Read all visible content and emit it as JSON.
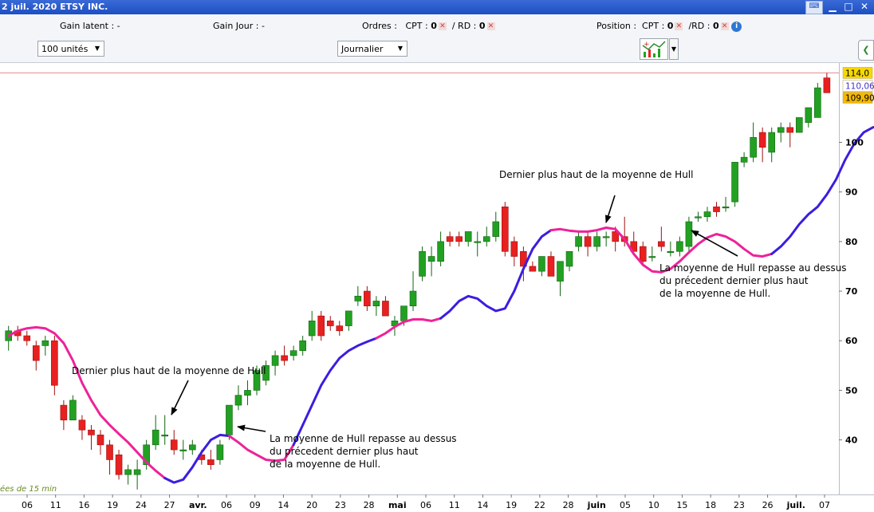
{
  "window": {
    "title": "2 juil. 2020 ETSY INC."
  },
  "infobar": {
    "gain_latent_label": "Gain latent :",
    "gain_latent_value": "-",
    "gain_jour_label": "Gain Jour :",
    "gain_jour_value": "-",
    "ordres_label": "Ordres :",
    "ordres_cpt_label": "CPT :",
    "ordres_cpt_value": "0",
    "ordres_rd_label": "/ RD :",
    "ordres_rd_value": "0",
    "position_label": "Position :",
    "position_cpt_label": "CPT :",
    "position_cpt_value": "0",
    "position_rd_label": "/RD :",
    "position_rd_value": "0"
  },
  "toolbar": {
    "units_value": "100 unités",
    "period_value": "Journalier"
  },
  "footer_note": "ées de 15 min",
  "annotations": [
    "Dernier plus haut de la moyenne de Hull",
    "La moyenne de Hull repasse au dessus\ndu précedent dernier plus haut\nde la moyenne de Hull.",
    "Dernier plus haut de la moyenne de Hull",
    "La moyenne de Hull repasse au dessus\ndu précedent dernier plus haut\nde la moyenne de Hull."
  ],
  "colors": {
    "up": "#22a022",
    "down": "#e82020",
    "hull_rising": "#3a1ee0",
    "hull_falling": "#ee2299",
    "price_line": "#e38a8a"
  },
  "chart_data": {
    "type": "candlestick",
    "ylim": [
      29,
      116
    ],
    "y_ticks": [
      40,
      50,
      60,
      70,
      80,
      90,
      100
    ],
    "x_tick_labels": [
      "06",
      "11",
      "16",
      "19",
      "24",
      "27",
      "avr.",
      "06",
      "09",
      "14",
      "20",
      "23",
      "28",
      "mai",
      "06",
      "11",
      "14",
      "19",
      "22",
      "28",
      "juin",
      "05",
      "10",
      "15",
      "18",
      "23",
      "26",
      "juil.",
      "07"
    ],
    "bold_x_labels": [
      "avr.",
      "mai",
      "juin",
      "juil."
    ],
    "price_tags": [
      {
        "label": "114,0",
        "value": 114.0
      },
      {
        "label": "110,06",
        "value": 110.06
      },
      {
        "label": "109,90",
        "value": 109.9
      }
    ],
    "candles": [
      [
        60,
        63,
        58,
        62
      ],
      [
        62,
        63,
        60,
        61
      ],
      [
        61,
        62,
        59,
        60
      ],
      [
        59,
        60,
        54,
        56
      ],
      [
        59,
        61,
        57,
        60
      ],
      [
        60,
        61,
        49,
        51
      ],
      [
        47,
        48,
        42,
        44
      ],
      [
        44,
        49,
        44,
        48
      ],
      [
        44,
        45,
        40,
        42
      ],
      [
        42,
        43,
        38,
        41
      ],
      [
        41,
        42,
        37,
        39
      ],
      [
        39,
        40,
        33,
        36
      ],
      [
        37,
        38,
        32,
        33
      ],
      [
        33,
        35,
        31,
        34
      ],
      [
        33,
        36,
        30,
        34
      ],
      [
        35,
        40,
        34,
        39
      ],
      [
        39,
        45,
        38,
        42
      ],
      [
        41,
        45,
        39,
        41
      ],
      [
        40,
        42,
        37,
        38
      ],
      [
        38,
        40,
        36,
        38
      ],
      [
        38,
        40,
        37,
        39
      ],
      [
        37,
        38,
        35,
        36
      ],
      [
        36,
        38,
        34,
        35
      ],
      [
        36,
        40,
        35,
        39
      ],
      [
        41,
        47,
        40,
        47
      ],
      [
        47,
        51,
        46,
        49
      ],
      [
        49,
        52,
        47,
        50
      ],
      [
        50,
        55,
        49,
        54
      ],
      [
        52,
        56,
        51,
        55
      ],
      [
        55,
        58,
        53,
        57
      ],
      [
        57,
        59,
        55,
        56
      ],
      [
        57,
        59,
        56,
        58
      ],
      [
        58,
        61,
        57,
        60
      ],
      [
        61,
        66,
        60,
        64
      ],
      [
        65,
        66,
        60,
        61
      ],
      [
        64,
        65,
        62,
        63
      ],
      [
        63,
        64,
        61,
        62
      ],
      [
        63,
        66,
        62,
        66
      ],
      [
        68,
        71,
        67,
        69
      ],
      [
        70,
        71,
        66,
        67
      ],
      [
        67,
        69,
        65,
        68
      ],
      [
        68,
        69,
        65,
        65
      ],
      [
        63,
        65,
        61,
        64
      ],
      [
        64,
        67,
        63,
        67
      ],
      [
        67,
        74,
        66,
        70
      ],
      [
        73,
        79,
        72,
        78
      ],
      [
        76,
        79,
        73,
        77
      ],
      [
        76,
        82,
        75,
        80
      ],
      [
        81,
        82,
        79,
        80
      ],
      [
        81,
        82,
        79,
        80
      ],
      [
        80,
        82,
        79,
        82
      ],
      [
        80,
        82,
        77,
        80
      ],
      [
        80,
        83,
        79,
        81
      ],
      [
        81,
        86,
        80,
        84
      ],
      [
        87,
        88,
        77,
        78
      ],
      [
        80,
        81,
        75,
        77
      ],
      [
        78,
        79,
        72,
        75
      ],
      [
        75,
        76,
        74,
        74
      ],
      [
        74,
        77,
        73,
        77
      ],
      [
        77,
        78,
        73,
        73
      ],
      [
        72,
        76,
        69,
        76
      ],
      [
        75,
        78,
        74,
        78
      ],
      [
        79,
        82,
        78,
        81
      ],
      [
        81,
        82,
        77,
        79
      ],
      [
        79,
        82,
        78,
        81
      ],
      [
        81,
        82,
        79,
        81
      ],
      [
        82,
        83,
        78,
        80
      ],
      [
        81,
        85,
        79,
        80
      ],
      [
        80,
        82,
        78,
        78
      ],
      [
        79,
        80,
        75,
        76
      ],
      [
        77,
        79,
        76,
        77
      ],
      [
        80,
        83,
        78,
        79
      ],
      [
        78,
        80,
        77,
        78
      ],
      [
        78,
        81,
        77,
        80
      ],
      [
        79,
        85,
        78,
        84
      ],
      [
        85,
        86,
        84,
        85
      ],
      [
        85,
        87,
        84,
        86
      ],
      [
        87,
        88,
        85,
        86
      ],
      [
        87,
        89,
        86,
        87
      ],
      [
        88,
        96,
        87,
        96
      ],
      [
        96,
        98,
        95,
        97
      ],
      [
        97,
        104,
        96,
        101
      ],
      [
        102,
        103,
        96,
        99
      ],
      [
        98,
        103,
        96,
        102
      ],
      [
        102,
        104,
        100,
        103
      ],
      [
        103,
        104,
        99,
        102
      ],
      [
        102,
        105,
        102,
        105
      ],
      [
        104,
        107,
        103,
        107
      ],
      [
        105,
        112,
        105,
        111
      ],
      [
        113,
        114,
        110,
        110
      ]
    ],
    "hull": [
      [
        61.0,
        62.0,
        62.5,
        62.7,
        62.5,
        61.5,
        59.5,
        56.0,
        51.5,
        48.0,
        45.0,
        43.0,
        41.2,
        39.5,
        37.5,
        35.5,
        33.8,
        32.3,
        31.4,
        32.0,
        34.5,
        37.5,
        40.0,
        41.0,
        40.8,
        39.5,
        38.0,
        37.0,
        36.0,
        35.8,
        36.0,
        39.0,
        43.0,
        47.0,
        51.0,
        54.0,
        56.5,
        58.0,
        59.0,
        59.8,
        60.5,
        61.5,
        62.8,
        63.8,
        64.3,
        64.3,
        64.0,
        64.5,
        66.0,
        68.0,
        69.0,
        68.5,
        67.0,
        66.0,
        66.5,
        70.0,
        74.5,
        78.5,
        81.0,
        82.3,
        82.5,
        82.2,
        82.0,
        82.0,
        82.3,
        82.8,
        82.5,
        80.5,
        77.5,
        75.3,
        74.0,
        73.8,
        74.5,
        76.0,
        77.8,
        79.5,
        80.8,
        81.5,
        81.0,
        80.0,
        78.5,
        77.2,
        77.0,
        77.5,
        79.0,
        81.0,
        83.5,
        85.5,
        87.0,
        89.5,
        92.5,
        96.5,
        99.8,
        102.0,
        103.0,
        103.5,
        104.5,
        106.5,
        109.0,
        110.06
      ]
    ],
    "hull_rising_ranges": [
      [
        17,
        24
      ],
      [
        31,
        40
      ],
      [
        47,
        59
      ],
      [
        83,
        106
      ]
    ]
  }
}
